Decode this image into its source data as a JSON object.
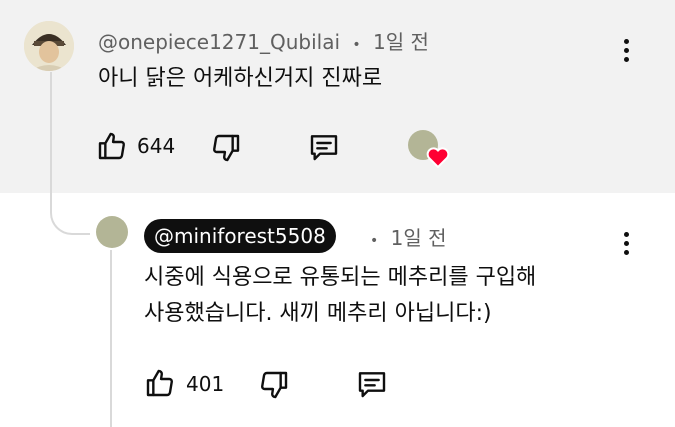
{
  "parent_comment": {
    "author": "@onepiece1271_Qubilai",
    "time": "1일 전",
    "separator": "•",
    "text": "아니 닭은 어케하신거지 진짜로",
    "likes": "644"
  },
  "reply": {
    "author": "@miniforest5508",
    "time": "1일 전",
    "separator": "•",
    "text_line1": "시중에 식용으로 유통되는 메추리를 구입해",
    "text_line2": "사용했습니다. 새끼 메추리 아닙니다:)",
    "likes": "401"
  },
  "colors": {
    "highlight_bg": "#f2f2f2",
    "heart": "#ff0033",
    "author_chip_bg": "#0f0f0f"
  },
  "icons": [
    "thumb-up-icon",
    "thumb-down-icon",
    "reply-icon",
    "more-options-icon",
    "creator-heart-icon"
  ]
}
